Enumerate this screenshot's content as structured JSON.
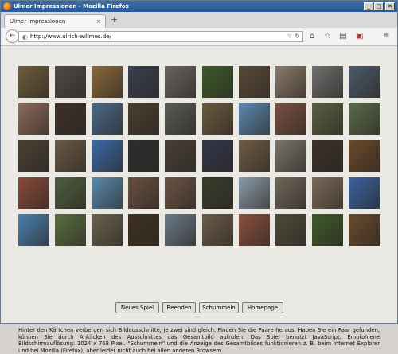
{
  "window": {
    "title": "Ulmer Impressionen - Mozilla Firefox",
    "minimize": "_",
    "maximize": "□",
    "close": "✕"
  },
  "tabs": [
    {
      "label": "Ulmer Impressionen",
      "close": "×"
    }
  ],
  "new_tab": "+",
  "toolbar": {
    "back": "←",
    "url": "http://www.ulrich-willmes.de/",
    "globe": "◐",
    "dropdown": "▽",
    "reload": "↻",
    "home": "⌂",
    "bookmark": "☆",
    "library": "▤",
    "addon": "▣",
    "menu": "≡"
  },
  "board": {
    "rows": 5,
    "cols": 10,
    "tile_colors": [
      [
        "#6f5c3c",
        "#4e4a44",
        "#8a6a3a",
        "#3a4050",
        "#6a6460",
        "#3e5a2a",
        "#5a4a38",
        "#8a7a6a",
        "#6f6f6f",
        "#4a5a6a"
      ],
      [
        "#8e6a5a",
        "#3e3028",
        "#4a6a8a",
        "#4a3e30",
        "#5a5a52",
        "#6a5a40",
        "#5a88b0",
        "#7a5040",
        "#5a6040",
        "#5a6a4a"
      ],
      [
        "#4a4034",
        "#6a5a46",
        "#3a6aa8",
        "#2e2e2e",
        "#484038",
        "#33364a",
        "#6e5c44",
        "#7a7468",
        "#3a3028",
        "#6a4a2a"
      ],
      [
        "#8a4a3a",
        "#4e5e3e",
        "#5a8ab0",
        "#6a5040",
        "#6a5444",
        "#383c2a",
        "#8a9aa8",
        "#6e6658",
        "#7a6a5a",
        "#3a62a0"
      ],
      [
        "#4a80b0",
        "#5a7040",
        "#6a6250",
        "#3e3020",
        "#6a7a88",
        "#6a5c4a",
        "#8a5040",
        "#4e4a3a",
        "#3e5a2a",
        "#6a4a2e"
      ]
    ]
  },
  "buttons": [
    "Neues Spiel",
    "Beenden",
    "Schummeln",
    "Homepage"
  ],
  "info_text": "Hinter den Kärtchen verbergen sich Bildausschnitte, je zwei sind gleich. Finden Sie die Paare heraus. Haben Sie ein Paar gefunden, können Sie durch Anklicken des Ausschnittes das Gesamtbild aufrufen. Das Spiel benutzt JavaScript. Empfohlene Bildschirmauflösung: 1024 x 768 Pixel. \"Schummeln\" und die Anzeige des Gesamtbildes funktionieren z. B. beim Internet Explorer und bei Mozilla (Firefox), aber leider nicht auch bei allen anderen Browsern."
}
